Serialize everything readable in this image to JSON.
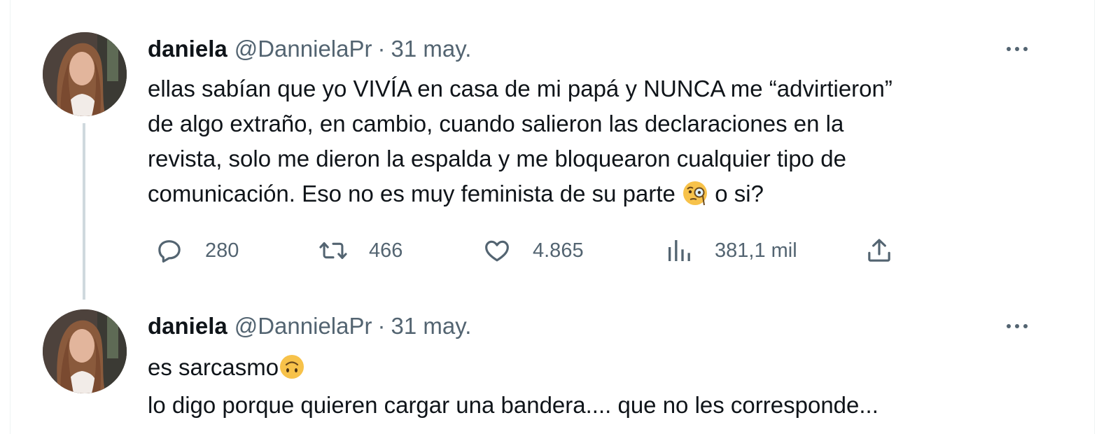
{
  "tweets": [
    {
      "author_name": "daniela",
      "author_handle": "@DannielaPr",
      "separator": "·",
      "date": "31 may.",
      "text_lines": [
        "ellas sabían que yo VIVÍA en casa de mi papá y NUNCA me “advirtieron”",
        "de algo extraño, en cambio, cuando salieron las declaraciones en la",
        "revista, solo me dieron la espalda y me bloquearon cualquier tipo de",
        "comunicación. Eso no es muy feminista de su parte",
        "o si?"
      ],
      "emoji": "face-with-monocle",
      "stats": {
        "replies": "280",
        "retweets": "466",
        "likes": "4.865",
        "views": "381,1 mil"
      }
    },
    {
      "author_name": "daniela",
      "author_handle": "@DannielaPr",
      "separator": "·",
      "date": "31 may.",
      "text_lines": [
        "es sarcasmo",
        "lo digo porque quieren cargar una bandera.... que no les corresponde..."
      ],
      "emoji": "upside-down-face"
    }
  ],
  "icons": {
    "reply": "reply-icon",
    "retweet": "retweet-icon",
    "like": "heart-icon",
    "views": "views-chart-icon",
    "share": "share-icon",
    "more": "more-options-icon"
  },
  "colors": {
    "text_primary": "#0f1419",
    "text_secondary": "#536471",
    "thread_line": "#cfd9de",
    "emoji_yellow": "#f7c24a"
  }
}
